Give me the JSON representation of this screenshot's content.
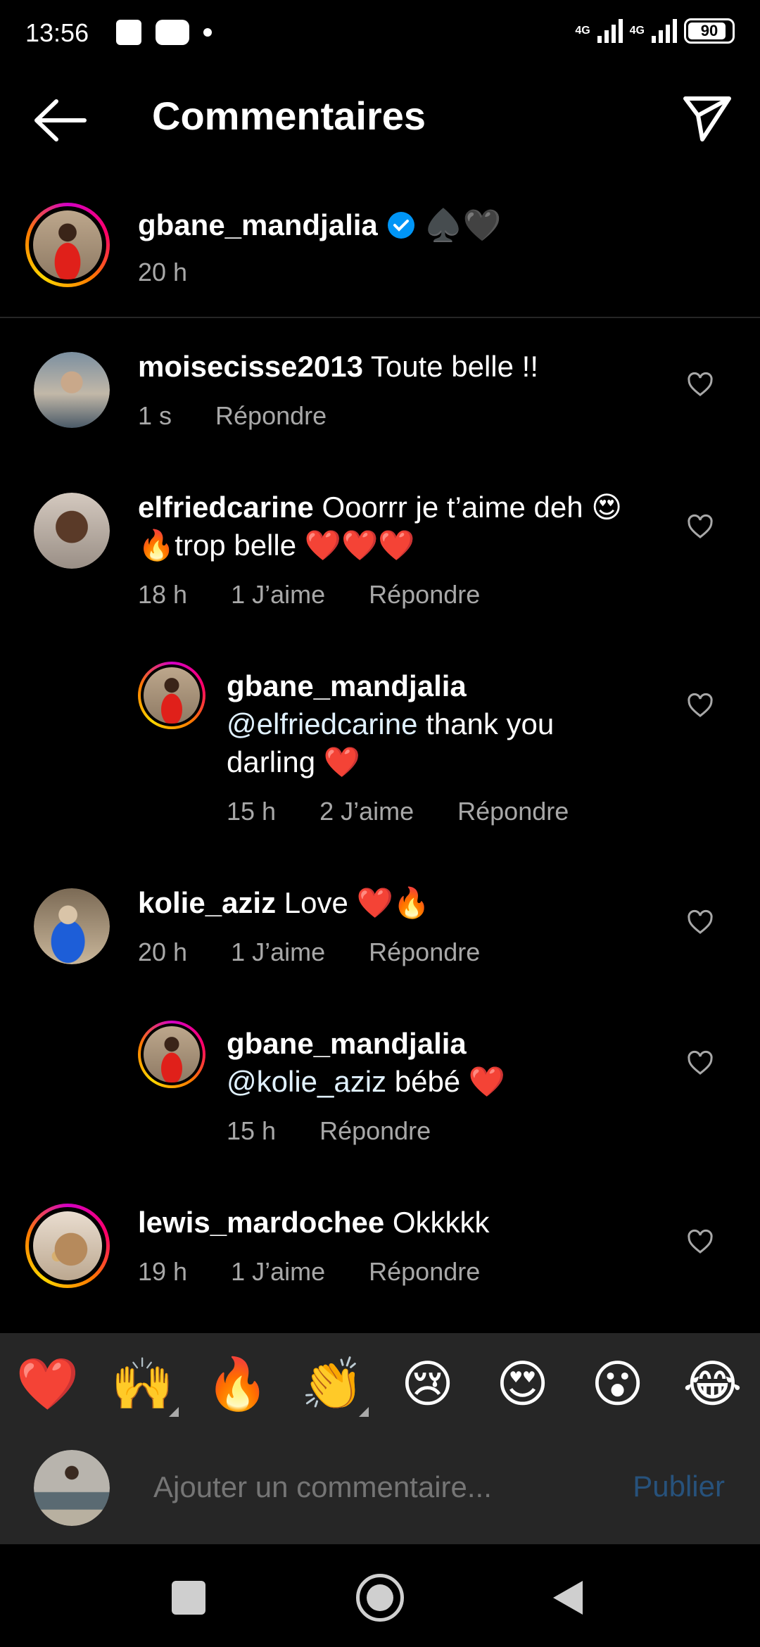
{
  "status_bar": {
    "time": "13:56",
    "network1": "4G",
    "network2": "4G",
    "battery": "90"
  },
  "header": {
    "title": "Commentaires"
  },
  "post": {
    "username": "gbane_mandjalia",
    "caption_emoji": "♠️🖤",
    "time": "20 h"
  },
  "comments": [
    {
      "username": "moisecisse2013",
      "text": "Toute belle !!",
      "time": "1 s",
      "likes": "",
      "reply": "Répondre"
    },
    {
      "username": "elfriedcarine",
      "text": "Ooorrr je t’aime deh 😍",
      "text2": "🔥trop belle ❤️❤️❤️",
      "time": "18 h",
      "likes": "1 J’aime",
      "reply": "Répondre"
    },
    {
      "username": "gbane_mandjalia",
      "mention": "@elfriedcarine",
      "text": "thank you",
      "text2": "darling ❤️",
      "time": "15 h",
      "likes": "2 J’aime",
      "reply": "Répondre"
    },
    {
      "username": "kolie_aziz",
      "text": "Love ❤️🔥",
      "time": "20 h",
      "likes": "1 J’aime",
      "reply": "Répondre"
    },
    {
      "username": "gbane_mandjalia",
      "mention": "@kolie_aziz",
      "text": "bébé ❤️",
      "time": "15 h",
      "likes": "",
      "reply": "Répondre"
    },
    {
      "username": "lewis_mardochee",
      "text": "Okkkkk",
      "time": "19 h",
      "likes": "1 J’aime",
      "reply": "Répondre"
    }
  ],
  "reactions": [
    "❤️",
    "🙌",
    "🔥",
    "👏",
    "😢",
    "😍",
    "😮",
    "😂"
  ],
  "composer": {
    "placeholder": "Ajouter un commentaire...",
    "publish": "Publier"
  },
  "colors": {
    "background": "#000000",
    "secondary_text": "#a8a8a8",
    "verified": "#0095f6",
    "publish_disabled": "#27527c"
  }
}
